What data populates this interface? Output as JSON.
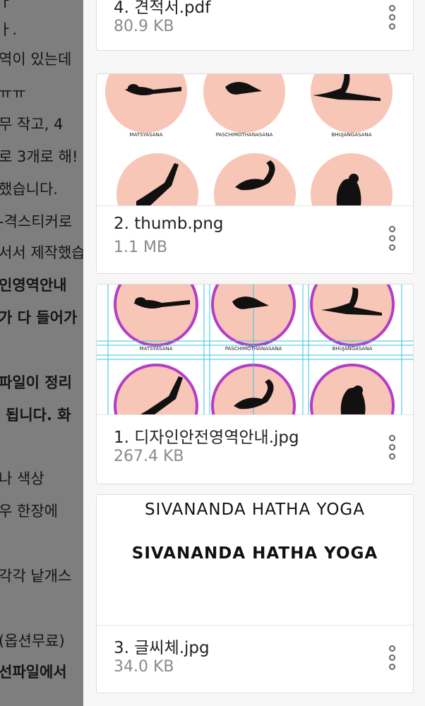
{
  "background_document": {
    "lines": [
      {
        "text": "ㅏ.",
        "bold": false
      },
      {
        "text": "역이 있는데",
        "bold": false
      },
      {
        "text": "ㅠㅠ",
        "bold": false
      },
      {
        "text": "무 작고, 4",
        "bold": false
      },
      {
        "text": "로 3개로 해!",
        "bold": false
      },
      {
        "text": "했습니다.",
        "bold": false
      },
      {
        "text": "-격스티커로",
        "bold": false
      },
      {
        "text": "서서 제작했습",
        "bold": false
      },
      {
        "text": "인영역안내",
        "bold": true
      },
      {
        "text": "가 다 들어가",
        "bold": true
      },
      {
        "text": "파일이 정리",
        "bold": true
      },
      {
        "text": "됩니다. 화",
        "bold": true
      },
      {
        "text": "나 색상",
        "bold": false
      },
      {
        "text": "우 한장에",
        "bold": false
      },
      {
        "text": "각각 낱개스",
        "bold": false
      },
      {
        "text": "(옵션무료)",
        "bold": false
      },
      {
        "text": "선파일에서",
        "bold": true
      }
    ]
  },
  "files": [
    {
      "name": "4. 견적서.pdf",
      "size": "80.9 KB"
    },
    {
      "name": "2. thumb.png",
      "size": "1.1 MB"
    },
    {
      "name": "1. 디자인안전영역안내.jpg",
      "size": "267.4 KB"
    },
    {
      "name": "3. 글씨체.jpg",
      "size": "34.0 KB"
    }
  ],
  "thumbnails": {
    "pose_labels": [
      "MATSYASANA",
      "PASCHIMOTHANASANA",
      "BHUJANGASANA"
    ],
    "font_sample_1": "SIVANANDA HATHA YOGA",
    "font_sample_2": "SIVANANDA HATHA YOGA"
  },
  "colors": {
    "circle_fill": "#f7c6b6",
    "guide_ring": "#b43cc8",
    "guide_line": "#35c6e0",
    "overlay": "#7e7e7e"
  }
}
